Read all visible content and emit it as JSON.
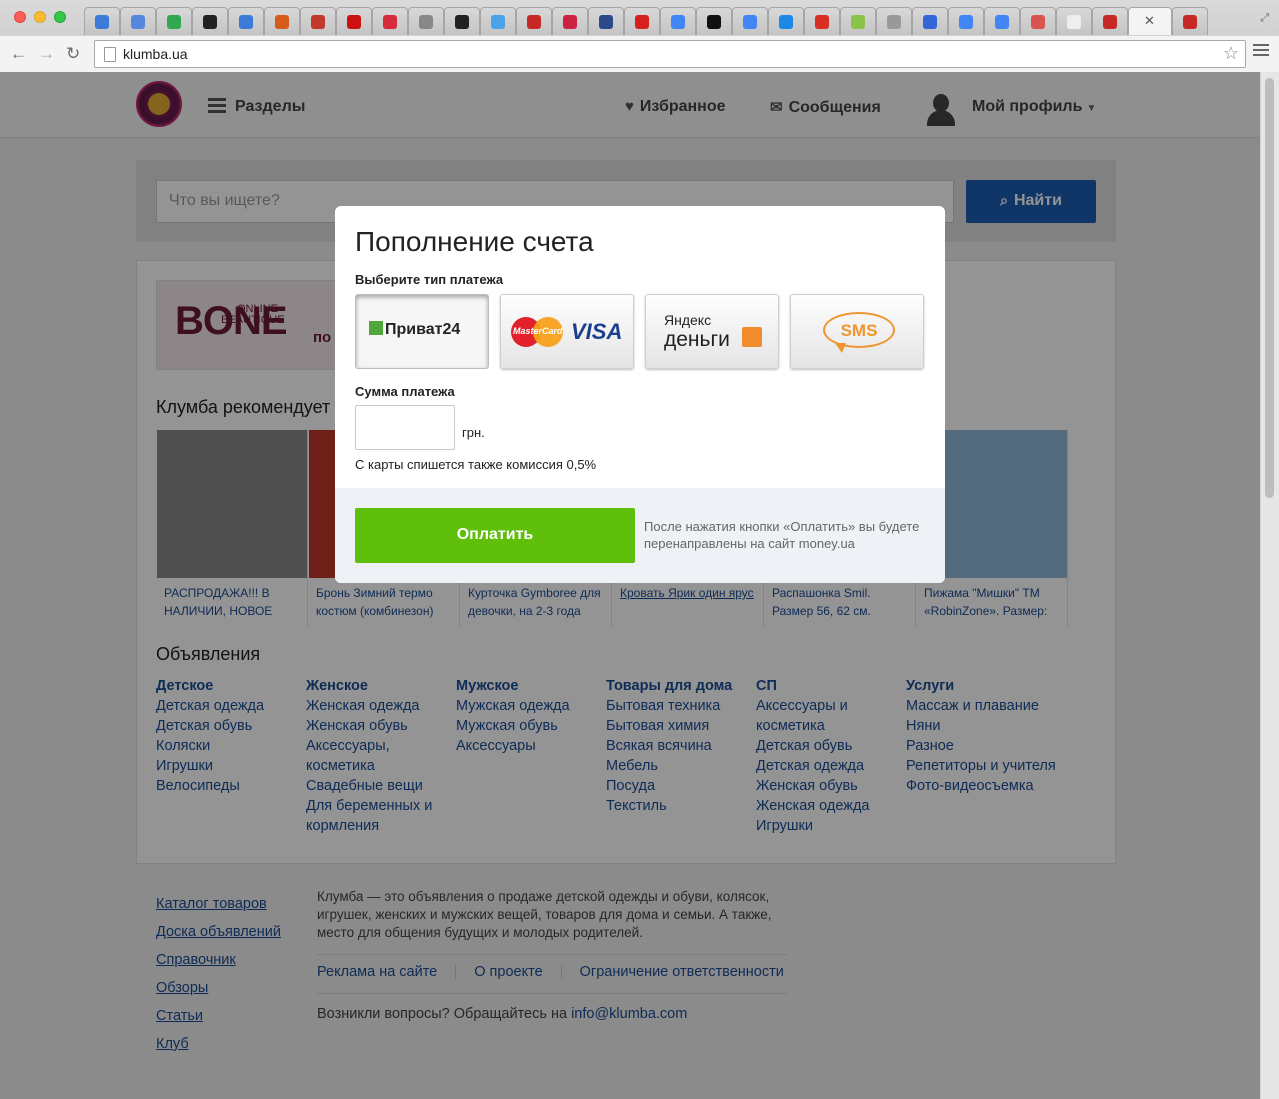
{
  "browser": {
    "url": "klumba.ua",
    "tab_favicon_colors": [
      "#3b7bd8",
      "#5588dd",
      "#2fa84f",
      "#222",
      "#3b7bd8",
      "#d65a1a",
      "#c0392b",
      "#cc1111",
      "#d62b3a",
      "#888",
      "#222",
      "#4aa3e8",
      "#c62828",
      "#cc2244",
      "#2a4a8a",
      "#d62020",
      "#4285f4",
      "#111",
      "#4285f4",
      "#1e88e5",
      "#d93025",
      "#8bc34a",
      "#999",
      "#3367d6",
      "#4285f4",
      "#4285f4",
      "#d9534f",
      "#eeeeee",
      "#c62828",
      "#f4d12a",
      "#c62828"
    ]
  },
  "header": {
    "sections": "Разделы",
    "favorites": "Избранное",
    "messages": "Сообщения",
    "profile": "Мой профиль"
  },
  "search": {
    "placeholder": "Что вы ищете?",
    "button": "Найти"
  },
  "banner": {
    "online": "ONLINE",
    "beautique": "BEAUTIQUE",
    "brand": "BONE",
    "cut_text": "по"
  },
  "recommends": {
    "title": "Клумба рекомендует",
    "items": [
      {
        "caption": "РАСПРОДАЖА!!! В НАЛИЧИИ, НОВОЕ",
        "color": "#8a8a8a"
      },
      {
        "caption": "Бронь Зимний термо костюм (комбинезон)",
        "color": "#c0392b"
      },
      {
        "caption": "Курточка Gymboree для девочки, на 2-3 года",
        "color": "#9e9e9e"
      },
      {
        "caption": "Кровать Ярик один ярус",
        "color": "#a0a0a0"
      },
      {
        "caption": "Распашонка Smil. Размер 56, 62 см.",
        "color": "#bdbdbd"
      },
      {
        "caption": "Пижама \"Мишки\" ТМ «RobinZone». Размер:",
        "color": "#90b8d6"
      }
    ]
  },
  "ads": {
    "title": "Объявления",
    "columns": [
      {
        "head": "Детское",
        "links": [
          "Детская одежда",
          "Детская обувь",
          "Коляски",
          "Игрушки",
          "Велосипеды"
        ]
      },
      {
        "head": "Женское",
        "links": [
          "Женская одежда",
          "Женская обувь",
          "Аксессуары, косметика",
          "Свадебные вещи",
          "Для беременных и кормления"
        ]
      },
      {
        "head": "Мужское",
        "links": [
          "Мужская одежда",
          "Мужская обувь",
          "Аксессуары"
        ]
      },
      {
        "head": "Товары для дома",
        "links": [
          "Бытовая техника",
          "Бытовая химия",
          "Всякая всячина",
          "Мебель",
          "Посуда",
          "Текстиль"
        ]
      },
      {
        "head": "СП",
        "links": [
          "Аксессуары и косметика",
          "Детская обувь",
          "Детская одежда",
          "Женская обувь",
          "Женская одежда",
          "Игрушки"
        ]
      },
      {
        "head": "Услуги",
        "links": [
          "Массаж и плавание",
          "Няни",
          "Разное",
          "Репетиторы и учителя",
          "Фото-видеосъемка"
        ]
      }
    ]
  },
  "footer": {
    "links": [
      "Каталог товаров",
      "Доска объявлений",
      "Справочник",
      "Обзоры",
      "Статьи",
      "Клуб"
    ],
    "about": "Клумба — это объявления о продаже детской одежды и обуви, колясок, игрушек, женских и мужских вещей, товаров для дома и семьи. А также, место для общения будущих и молодых родителей.",
    "nav": [
      "Реклама на сайте",
      "О проекте",
      "Ограничение ответственности"
    ],
    "questions": "Возникли вопросы? Обращайтесь на",
    "email": "info@klumba.com"
  },
  "modal": {
    "title": "Пополнение счета",
    "pay_type_label": "Выберите тип платежа",
    "methods": {
      "privat": "Приват24",
      "mastercard": "MasterCard",
      "visa": "VISA",
      "yandex_1": "Яндекс",
      "yandex_2": "деньги",
      "sms": "SMS"
    },
    "sum_label": "Сумма платежа",
    "currency": "грн.",
    "fee_note": "С карты спишется также комиссия 0,5%",
    "pay_button": "Оплатить",
    "redirect_note": "После нажатия кнопки «Оплатить» вы будете перенаправлены на сайт money.ua"
  }
}
